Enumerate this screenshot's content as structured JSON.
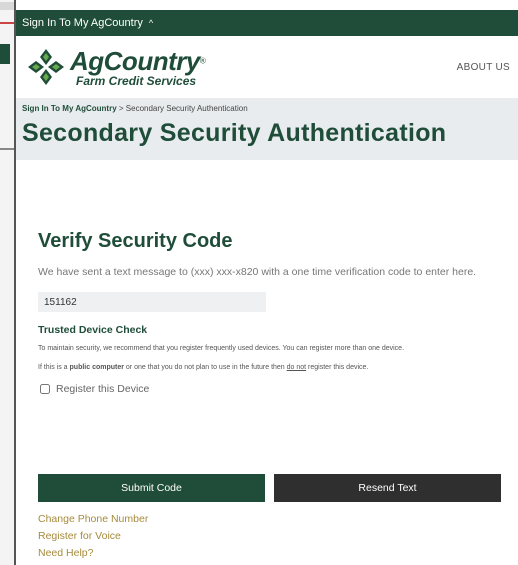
{
  "topbar": {
    "label": "Sign In To My AgCountry",
    "chevron": "^"
  },
  "brand": {
    "name": "AgCountry",
    "registered": "®",
    "subtitle": "Farm Credit Services",
    "color": "#1f4d39"
  },
  "nav": {
    "about": "ABOUT US"
  },
  "breadcrumb": {
    "root": "Sign In To My AgCountry",
    "separator": ">",
    "current": "Secondary Security Authentication"
  },
  "page_title": "Secondary Security Authentication",
  "verify": {
    "title": "Verify Security Code",
    "intro": "We have sent a text message to (xxx) xxx-x820 with a one time verification code to enter here.",
    "code_value": "151162"
  },
  "trusted": {
    "title": "Trusted Device Check",
    "note1": "To maintain security, we recommend that you register frequently used devices. You can register more than one device.",
    "note2_pre": "If this is a ",
    "note2_bold": "public computer",
    "note2_mid": " or one that you do not plan to use in the future then ",
    "note2_under": "do not",
    "note2_post": " register this device.",
    "checkbox_label": "Register this Device",
    "checked": false
  },
  "buttons": {
    "submit": "Submit Code",
    "resend": "Resend Text"
  },
  "links": {
    "change_phone": "Change Phone Number",
    "register_voice": "Register for Voice",
    "need_help": "Need Help?"
  },
  "colors": {
    "primary": "#1f4d39",
    "dark_button": "#2f2f2f",
    "link": "#a58b3d",
    "band": "#e9ecee"
  }
}
